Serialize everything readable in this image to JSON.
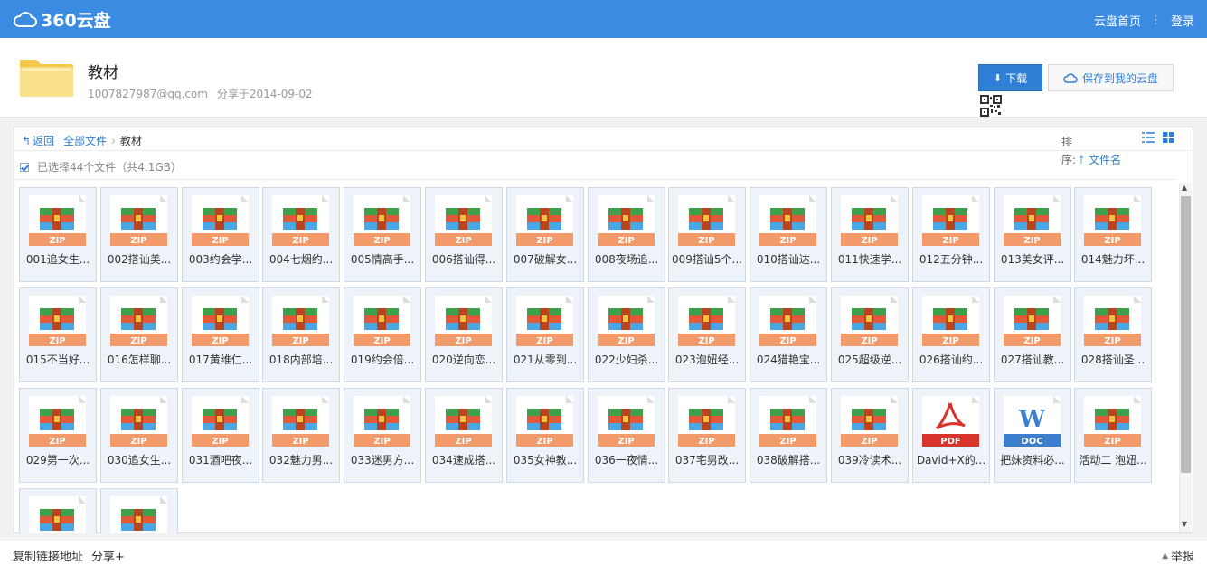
{
  "brand": {
    "name": "360云盘",
    "color": "#3b8be3"
  },
  "top_links": {
    "home": "云盘首页",
    "separator": "⋮",
    "login": "登录"
  },
  "share": {
    "title": "教材",
    "owner": "1007827987@qq.com",
    "shared_date": "分享于2014-09-02",
    "download_label": "下载",
    "save_label": "保存到我的云盘"
  },
  "breadcrumb": {
    "back": "返回",
    "all_files": "全部文件",
    "separator": "›",
    "current": "教材"
  },
  "sort": {
    "label": "排序:",
    "field": "文件名"
  },
  "selection": {
    "text": "已选择44个文件（共4.1GB）"
  },
  "files": [
    {
      "name": "001追女生...",
      "type": "ZIP"
    },
    {
      "name": "002搭讪美...",
      "type": "ZIP"
    },
    {
      "name": "003约会学...",
      "type": "ZIP"
    },
    {
      "name": "004七烟约...",
      "type": "ZIP"
    },
    {
      "name": "005情高手...",
      "type": "ZIP"
    },
    {
      "name": "006搭讪得...",
      "type": "ZIP"
    },
    {
      "name": "007破解女...",
      "type": "ZIP"
    },
    {
      "name": "008夜场追...",
      "type": "ZIP"
    },
    {
      "name": "009搭讪5个...",
      "type": "ZIP"
    },
    {
      "name": "010搭讪达...",
      "type": "ZIP"
    },
    {
      "name": "011快速学...",
      "type": "ZIP"
    },
    {
      "name": "012五分钟...",
      "type": "ZIP"
    },
    {
      "name": "013美女评...",
      "type": "ZIP"
    },
    {
      "name": "014魅力坏...",
      "type": "ZIP"
    },
    {
      "name": "015不当好...",
      "type": "ZIP"
    },
    {
      "name": "016怎样聊...",
      "type": "ZIP"
    },
    {
      "name": "017黄维仁...",
      "type": "ZIP"
    },
    {
      "name": "018内部培...",
      "type": "ZIP"
    },
    {
      "name": "019约会倍...",
      "type": "ZIP"
    },
    {
      "name": "020逆向恋...",
      "type": "ZIP"
    },
    {
      "name": "021从零到...",
      "type": "ZIP"
    },
    {
      "name": "022少妇杀...",
      "type": "ZIP"
    },
    {
      "name": "023泡妞经...",
      "type": "ZIP"
    },
    {
      "name": "024猎艳宝...",
      "type": "ZIP"
    },
    {
      "name": "025超级逆...",
      "type": "ZIP"
    },
    {
      "name": "026搭讪约...",
      "type": "ZIP"
    },
    {
      "name": "027搭讪教...",
      "type": "ZIP"
    },
    {
      "name": "028搭讪圣...",
      "type": "ZIP"
    },
    {
      "name": "029第一次...",
      "type": "ZIP"
    },
    {
      "name": "030追女生...",
      "type": "ZIP"
    },
    {
      "name": "031酒吧夜...",
      "type": "ZIP"
    },
    {
      "name": "032魅力男...",
      "type": "ZIP"
    },
    {
      "name": "033迷男方...",
      "type": "ZIP"
    },
    {
      "name": "034速成搭...",
      "type": "ZIP"
    },
    {
      "name": "035女神教...",
      "type": "ZIP"
    },
    {
      "name": "036一夜情...",
      "type": "ZIP"
    },
    {
      "name": "037宅男改...",
      "type": "ZIP"
    },
    {
      "name": "038破解搭...",
      "type": "ZIP"
    },
    {
      "name": "039冷读术...",
      "type": "ZIP"
    },
    {
      "name": "David+X的...",
      "type": "PDF"
    },
    {
      "name": "把妹资料必...",
      "type": "DOC"
    },
    {
      "name": "活动二 泡妞...",
      "type": "ZIP"
    },
    {
      "name": "",
      "type": "ZIP"
    },
    {
      "name": "",
      "type": "ZIP"
    }
  ],
  "footer": {
    "copy_link": "复制链接地址",
    "share": "分享+",
    "report": "举报"
  }
}
